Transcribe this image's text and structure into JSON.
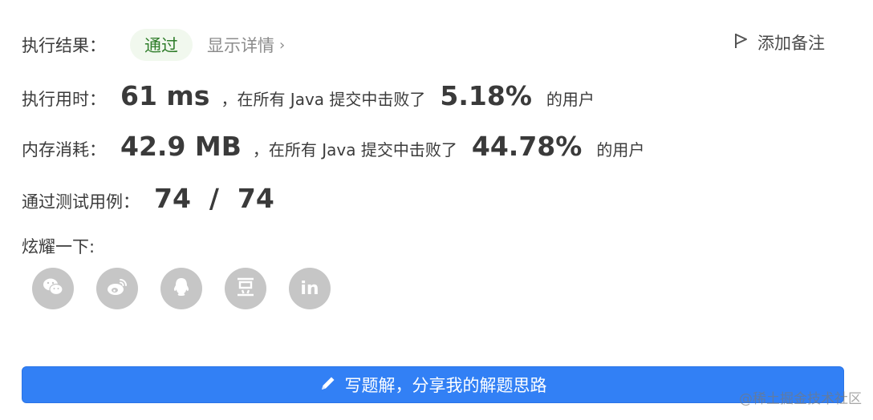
{
  "result": {
    "label": "执行结果：",
    "status": "通过",
    "details_link": "显示详情",
    "details_chevron": "›"
  },
  "note": {
    "label": "添加备注",
    "icon": "flag-icon"
  },
  "runtime": {
    "label": "执行用时：",
    "value": "61 ms",
    "middle_text": "，在所有 Java 提交中击败了",
    "percent": "5.18%",
    "suffix": "的用户"
  },
  "memory": {
    "label": "内存消耗：",
    "value": "42.9 MB",
    "middle_text": "，在所有 Java 提交中击败了",
    "percent": "44.78%",
    "suffix": "的用户"
  },
  "testcases": {
    "label": "通过测试用例：",
    "value": "74  /  74"
  },
  "share": {
    "label": "炫耀一下:",
    "icons": [
      "wechat-icon",
      "weibo-icon",
      "qq-icon",
      "douban-icon",
      "linkedin-icon"
    ],
    "douban_glyph": "豆",
    "linkedin_glyph": "in"
  },
  "write_solution": {
    "label": "写题解，分享我的解题思路",
    "icon": "pencil-icon"
  },
  "watermark": "@稀土掘金技术社区",
  "colors": {
    "accent": "#3280f5",
    "success": "#2f7d2a",
    "success_bg": "#f1f8ee",
    "icon_gray": "#c6c6c6"
  }
}
